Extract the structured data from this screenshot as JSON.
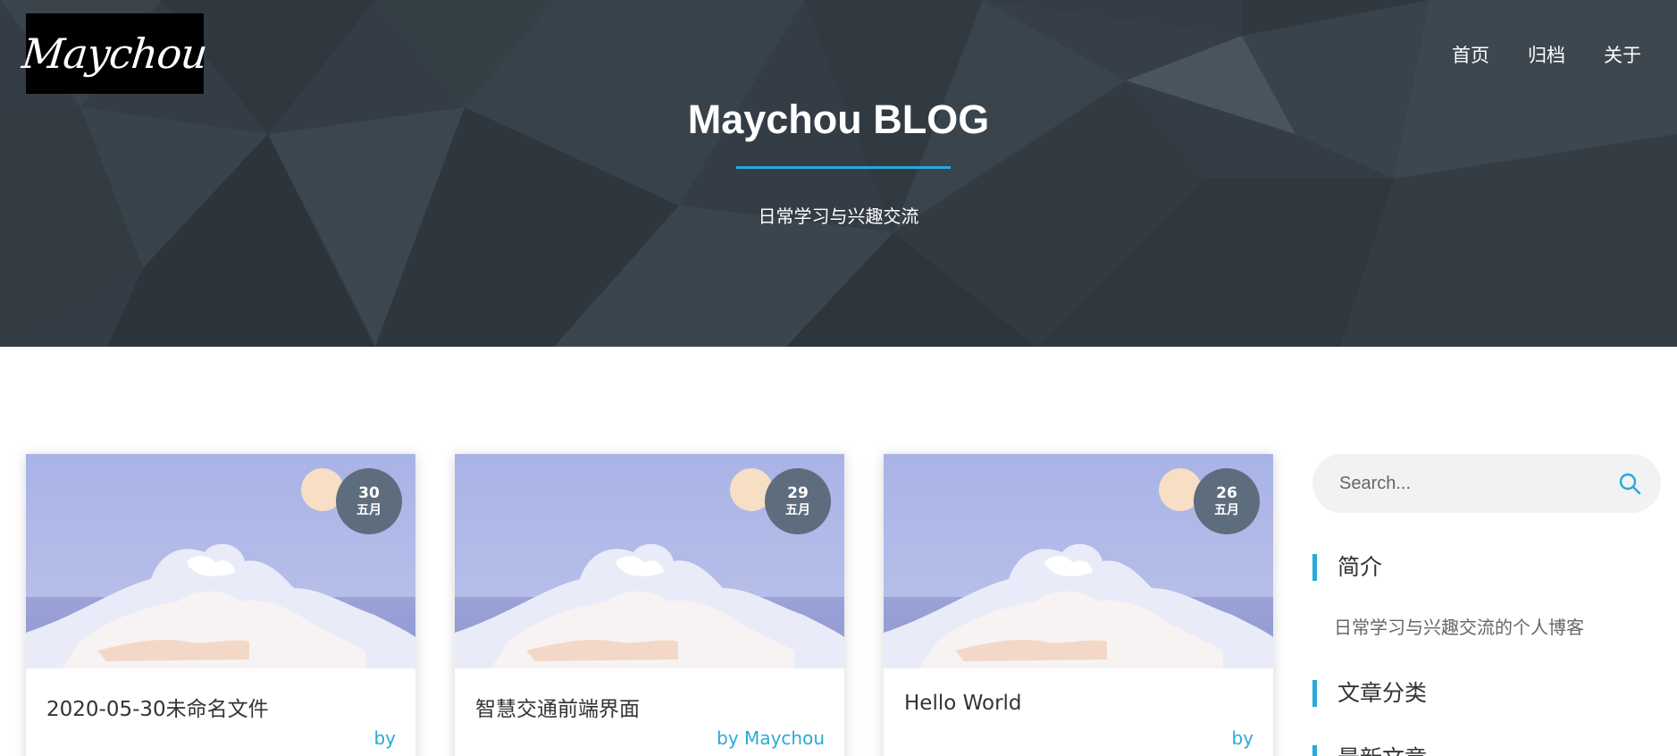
{
  "header": {
    "logo_text": "Maychou",
    "nav": [
      "首页",
      "归档",
      "关于"
    ],
    "title": "Maychou BLOG",
    "subtitle": "日常学习与兴趣交流"
  },
  "posts": [
    {
      "day": "30",
      "month": "五月",
      "title": "2020-05-30未命名文件",
      "by": "by"
    },
    {
      "day": "29",
      "month": "五月",
      "title": "智慧交通前端界面",
      "by": "by Maychou"
    },
    {
      "day": "26",
      "month": "五月",
      "title": "Hello World",
      "by": "by"
    }
  ],
  "sidebar": {
    "search_placeholder": "Search...",
    "intro_title": "简介",
    "intro_text": "日常学习与兴趣交流的个人博客",
    "categories_title": "文章分类",
    "recent_title": "最新文章"
  },
  "colors": {
    "accent": "#29a9d8",
    "hero_bg": "#343d45",
    "badge": "#5d6d7e"
  }
}
